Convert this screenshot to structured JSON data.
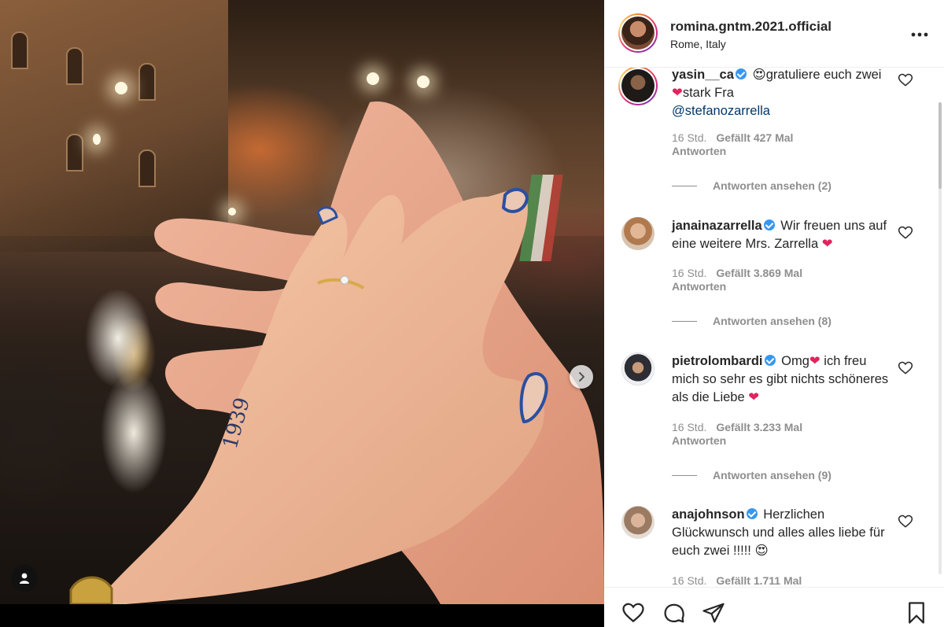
{
  "post": {
    "username": "romina.gntm.2021.official",
    "location": "Rome, Italy",
    "tattoo_text": "1939"
  },
  "comments": [
    {
      "username": "yasin__ca",
      "verified": true,
      "text_parts": [
        "gratuliere euch zwei",
        "stark Fra"
      ],
      "mention": "@stefanozarrella",
      "time": "16 Std.",
      "likes": "Gefällt 427 Mal",
      "reply_label": "Antworten",
      "view_replies": "Antworten ansehen (2)"
    },
    {
      "username": "janainazarrella",
      "verified": true,
      "text": "Wir freuen uns auf eine weitere Mrs. Zarrella",
      "time": "16 Std.",
      "likes": "Gefällt 3.869 Mal",
      "reply_label": "Antworten",
      "view_replies": "Antworten ansehen (8)"
    },
    {
      "username": "pietrolombardi",
      "verified": true,
      "text_parts": [
        "Omg",
        "ich freu mich so sehr es gibt nichts schöneres als die Liebe"
      ],
      "time": "16 Std.",
      "likes": "Gefällt 3.233 Mal",
      "reply_label": "Antworten",
      "view_replies": "Antworten ansehen (9)"
    },
    {
      "username": "anajohnson",
      "verified": true,
      "text": "Herzlichen Glückwunsch und alles alles liebe für euch zwei !!!!!",
      "time": "16 Std.",
      "likes": "Gefällt 1.711 Mal"
    }
  ],
  "icons": {
    "heart": "heart-icon",
    "comment": "comment-icon",
    "share": "share-icon",
    "save": "bookmark-icon",
    "more": "more-options-icon",
    "next": "chevron-right-icon",
    "tag": "user-tag-icon"
  },
  "colors": {
    "text": "#262626",
    "meta": "#8e8e8e",
    "mention": "#00376b",
    "verified": "#3897f0",
    "heart": "#e0245e"
  }
}
